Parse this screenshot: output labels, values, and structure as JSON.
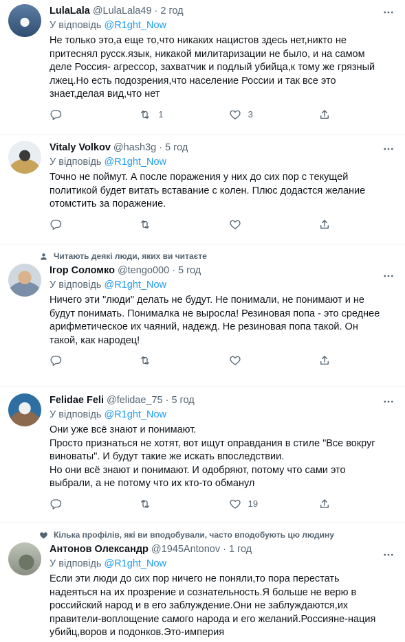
{
  "reply_prefix": "У відповідь",
  "tweets": [
    {
      "social": "",
      "name": "LulaLala",
      "handle": "@LulaLala49",
      "time": "2 год",
      "reply_to": "@R1ght_Now",
      "lines": [
        "Не только это,а еще то,что никаких нацистов здесь нет,никто не",
        "притеснял русск.язык, никакой милитаризации не было, и на самом",
        "деле Россия- агрессор, захватчик и подлый убийца,к тому же грязный",
        "лжец.Но есть подозрения,что население России и так все это",
        "знает,делая вид,что нет"
      ],
      "replies": "",
      "retweets": "1",
      "likes": "3"
    },
    {
      "social": "",
      "name": "Vitaly Volkov",
      "handle": "@hash3g",
      "time": "5 год",
      "reply_to": "@R1ght_Now",
      "lines": [
        "Точно не поймут. А после поражения у них до сих пор с текущей",
        "политикой будет витать вставание с колен. Плюс додастся желание",
        "отомстить за поражение."
      ],
      "replies": "",
      "retweets": "",
      "likes": ""
    },
    {
      "social": "Читають деякі люди, яких ви читаєте",
      "name": "Ігор Соломко",
      "handle": "@tengo000",
      "time": "5 год",
      "reply_to": "@R1ght_Now",
      "lines": [
        "Ничего эти \"люди\" делать не будут. Не понимали, не понимают и не",
        "будут понимать. Понималка не выросла! Резиновая попа - это среднее",
        "арифметическое их чаяний, надежд. Не резиновая попа такой. Он",
        "такой, как народец!"
      ],
      "replies": "",
      "retweets": "",
      "likes": ""
    },
    {
      "social": "",
      "name": "Felidae Feli",
      "handle": "@felidae_75",
      "time": "5 год",
      "reply_to": "@R1ght_Now",
      "lines": [
        "Они уже всё знают и понимают.",
        "Просто признаться не хотят, вот ищут оправдания в стиле \"Все вокруг",
        "виноваты\". И будут такие же искать впоследствии.",
        "Но они всё знают и понимают. И одобряют, потому что сами это",
        "выбрали, а не потому что их кто-то обманул"
      ],
      "replies": "",
      "retweets": "",
      "likes": "19"
    },
    {
      "social": "Кілька профілів, які ви вподобували, часто вподобують цю людину",
      "name": "Антонов Олександр",
      "handle": "@1945Antonov",
      "time": "1 год",
      "reply_to": "@R1ght_Now",
      "lines": [
        "Если эти люди до сих пор ничего не поняли,то пора перестать",
        "надеяться на их прозрение и сознательность.Я больше не верю в",
        "российский народ и в его заблуждение.Они не заблуждаются,их",
        "правители-воплощение самого народа и его желаний.Россияне-нация",
        "убийц,воров и подонков.Это-империя"
      ],
      "replies": "",
      "retweets": "",
      "likes": ""
    }
  ],
  "colors": {
    "accent": "#1d9bf0",
    "secondary_text": "#536471",
    "text": "#0f1419",
    "divider": "#eff3f4"
  },
  "icons": [
    "more-icon",
    "reply-icon",
    "retweet-icon",
    "like-icon",
    "share-icon",
    "person-icon",
    "heart-icon"
  ]
}
